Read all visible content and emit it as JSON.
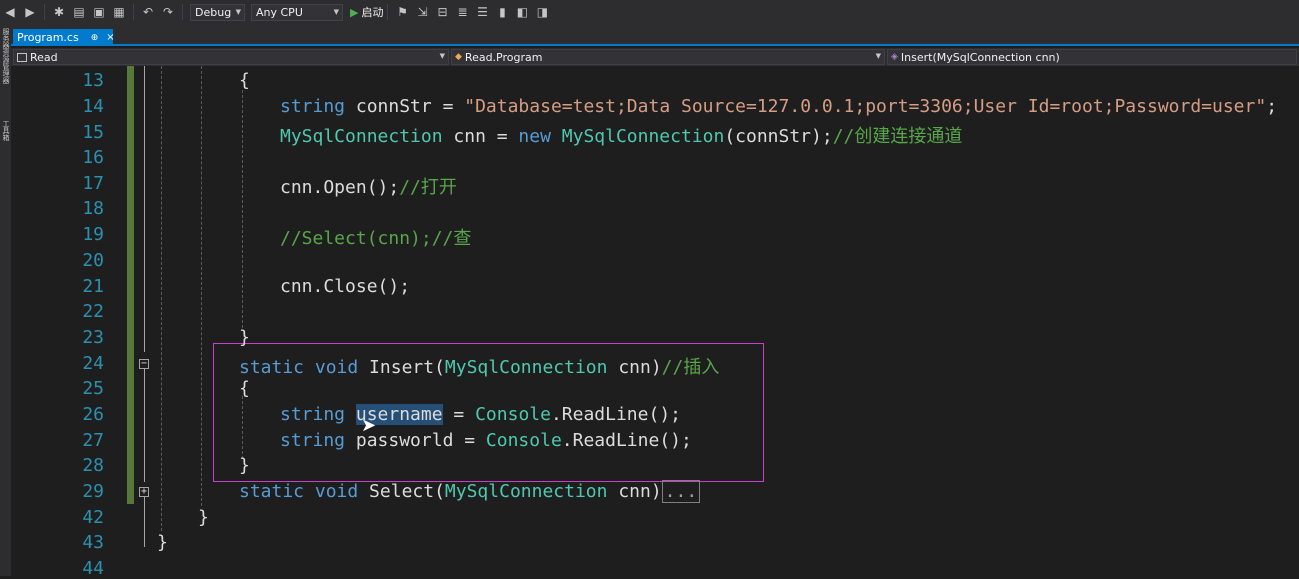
{
  "toolbar": {
    "config": "Debug",
    "platform": "Any CPU",
    "start_label": "启动"
  },
  "left_strip": {
    "label1": "服务器资源管理器",
    "label2": "工具箱"
  },
  "tab": {
    "filename": "Program.cs",
    "pin": "⊕",
    "close": "×"
  },
  "nav": {
    "project": "Read",
    "class": "Read.Program",
    "member": "Insert(MySqlConnection cnn)"
  },
  "line_numbers": [
    "13",
    "14",
    "15",
    "16",
    "17",
    "18",
    "19",
    "20",
    "21",
    "22",
    "23",
    "24",
    "25",
    "26",
    "27",
    "28",
    "29",
    "42",
    "43",
    "44"
  ],
  "code": {
    "l13": "{",
    "l14_kw": "string",
    "l14_a": " connStr = ",
    "l14_str": "\"Database=test;Data Source=127.0.0.1;port=3306;User Id=root;Password=user\"",
    "l14_end": ";",
    "l15_ty": "MySqlConnection",
    "l15_a": " cnn = ",
    "l15_kw": "new",
    "l15_ty2": " MySqlConnection",
    "l15_b": "(connStr);",
    "l15_cm": "//创建连接通道",
    "l17_a": "cnn.Open();",
    "l17_cm": "//打开",
    "l19_cm": "//Select(cnn);//查",
    "l21_a": "cnn.Close();",
    "l23": "}",
    "l24_kw": "static void",
    "l24_a": " Insert(",
    "l24_ty": "MySqlConnection",
    "l24_b": " cnn)",
    "l24_cm": "//插入",
    "l25": "{",
    "l26_kw": "string",
    "l26_sel": "username",
    "l26_a": " = ",
    "l26_ty": "Console",
    "l26_b": ".ReadLine();",
    "l27_kw": "string",
    "l27_a": " passworld = ",
    "l27_ty": "Console",
    "l27_b": ".ReadLine();",
    "l28": "}",
    "l29_kw": "static void",
    "l29_a": " Select(",
    "l29_ty": "MySqlConnection",
    "l29_b": " cnn)",
    "l29_collapsed": "...",
    "l42": "}",
    "l43": "}"
  }
}
